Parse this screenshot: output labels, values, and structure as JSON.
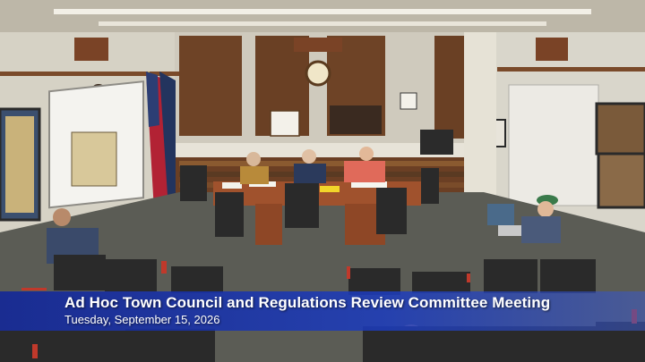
{
  "overlay": {
    "title": "Ad Hoc Town Council and Regulations Review Committee Meeting",
    "date": "Tuesday, September 15, 2026"
  },
  "colors": {
    "banner": "#1c3cbe",
    "carpet": "#5b5c55",
    "wall": "#dcd8cc",
    "table": "#a0522d",
    "chair_accent": "#c0392b"
  }
}
